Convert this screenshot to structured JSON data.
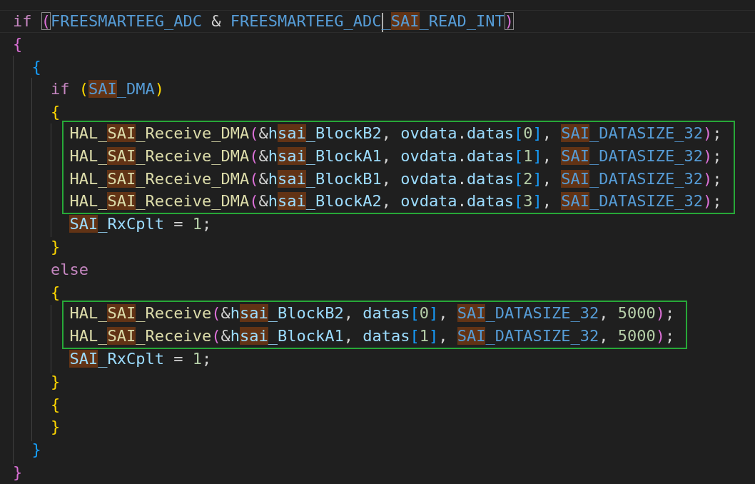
{
  "editor": {
    "blocks": [
      {
        "kind": "line",
        "current": true,
        "tokens": [
          {
            "text": "if ",
            "kind": "keyword",
            "highlighted": false
          },
          {
            "text": "(",
            "kind": "bracket",
            "color": "#da70d6",
            "matched": true,
            "highlighted": false
          },
          {
            "text": "FREESMARTEEG_ADC",
            "kind": "macro",
            "highlighted": false
          },
          {
            "text": " & ",
            "kind": "operator",
            "highlighted": false
          },
          {
            "text": "FREESMARTEEG_ADC",
            "kind": "macro",
            "highlighted": false
          },
          {
            "kind": "cursor"
          },
          {
            "text": "_",
            "kind": "macro",
            "highlighted": false
          },
          {
            "text": "SAI",
            "kind": "macro",
            "highlighted": true
          },
          {
            "text": "_READ_INT",
            "kind": "macro",
            "highlighted": false
          },
          {
            "text": ")",
            "kind": "bracket",
            "color": "#da70d6",
            "matched": true,
            "highlighted": false
          }
        ]
      },
      {
        "kind": "line",
        "current": false,
        "tokens": [
          {
            "text": "{",
            "kind": "bracket",
            "color": "#da70d6",
            "matched": false,
            "highlighted": false
          }
        ]
      },
      {
        "kind": "line",
        "current": false,
        "tokens": [
          {
            "text": "  {",
            "kind": "bracket",
            "color": "#179fff",
            "matched": false,
            "highlighted": false
          }
        ]
      },
      {
        "kind": "line",
        "current": false,
        "tokens": [
          {
            "text": "    if ",
            "kind": "keyword",
            "highlighted": false
          },
          {
            "text": "(",
            "kind": "bracket",
            "color": "#ffd700",
            "matched": false,
            "highlighted": false
          },
          {
            "text": "SAI",
            "kind": "macro",
            "highlighted": true
          },
          {
            "text": "_DMA",
            "kind": "macro",
            "highlighted": false
          },
          {
            "text": ")",
            "kind": "bracket",
            "color": "#ffd700",
            "matched": false,
            "highlighted": false
          }
        ]
      },
      {
        "kind": "line",
        "current": false,
        "tokens": [
          {
            "text": "    {",
            "kind": "bracket",
            "color": "#ffd700",
            "matched": false,
            "highlighted": false
          }
        ]
      },
      {
        "kind": "boxed_group",
        "lines": [
          {
            "current": false,
            "tokens": [
              {
                "text": "      HAL_",
                "kind": "function",
                "highlighted": false
              },
              {
                "text": "SAI",
                "kind": "function",
                "highlighted": true
              },
              {
                "text": "_Receive_DMA",
                "kind": "function",
                "highlighted": false
              },
              {
                "text": "(",
                "kind": "bracket",
                "color": "#da70d6",
                "matched": false,
                "highlighted": false
              },
              {
                "text": "&",
                "kind": "operator",
                "highlighted": false
              },
              {
                "text": "h",
                "kind": "variable",
                "highlighted": false
              },
              {
                "text": "sai",
                "kind": "variable",
                "highlighted": true
              },
              {
                "text": "_BlockB2",
                "kind": "variable",
                "highlighted": false
              },
              {
                "text": ", ",
                "kind": "operator",
                "highlighted": false
              },
              {
                "text": "ovdata",
                "kind": "variable",
                "highlighted": false
              },
              {
                "text": ".",
                "kind": "operator",
                "highlighted": false
              },
              {
                "text": "datas",
                "kind": "variable",
                "highlighted": false
              },
              {
                "text": "[",
                "kind": "bracket",
                "color": "#179fff",
                "matched": false,
                "highlighted": false
              },
              {
                "text": "0",
                "kind": "number",
                "highlighted": false
              },
              {
                "text": "]",
                "kind": "bracket",
                "color": "#179fff",
                "matched": false,
                "highlighted": false
              },
              {
                "text": ", ",
                "kind": "operator",
                "highlighted": false
              },
              {
                "text": "SAI",
                "kind": "macro",
                "highlighted": true
              },
              {
                "text": "_DATASIZE_32",
                "kind": "macro",
                "highlighted": false
              },
              {
                "text": ")",
                "kind": "bracket",
                "color": "#da70d6",
                "matched": false,
                "highlighted": false
              },
              {
                "text": ";",
                "kind": "operator",
                "highlighted": false
              }
            ]
          },
          {
            "current": false,
            "tokens": [
              {
                "text": "      HAL_",
                "kind": "function",
                "highlighted": false
              },
              {
                "text": "SAI",
                "kind": "function",
                "highlighted": true
              },
              {
                "text": "_Receive_DMA",
                "kind": "function",
                "highlighted": false
              },
              {
                "text": "(",
                "kind": "bracket",
                "color": "#da70d6",
                "matched": false,
                "highlighted": false
              },
              {
                "text": "&",
                "kind": "operator",
                "highlighted": false
              },
              {
                "text": "h",
                "kind": "variable",
                "highlighted": false
              },
              {
                "text": "sai",
                "kind": "variable",
                "highlighted": true
              },
              {
                "text": "_BlockA1",
                "kind": "variable",
                "highlighted": false
              },
              {
                "text": ", ",
                "kind": "operator",
                "highlighted": false
              },
              {
                "text": "ovdata",
                "kind": "variable",
                "highlighted": false
              },
              {
                "text": ".",
                "kind": "operator",
                "highlighted": false
              },
              {
                "text": "datas",
                "kind": "variable",
                "highlighted": false
              },
              {
                "text": "[",
                "kind": "bracket",
                "color": "#179fff",
                "matched": false,
                "highlighted": false
              },
              {
                "text": "1",
                "kind": "number",
                "highlighted": false
              },
              {
                "text": "]",
                "kind": "bracket",
                "color": "#179fff",
                "matched": false,
                "highlighted": false
              },
              {
                "text": ", ",
                "kind": "operator",
                "highlighted": false
              },
              {
                "text": "SAI",
                "kind": "macro",
                "highlighted": true
              },
              {
                "text": "_DATASIZE_32",
                "kind": "macro",
                "highlighted": false
              },
              {
                "text": ")",
                "kind": "bracket",
                "color": "#da70d6",
                "matched": false,
                "highlighted": false
              },
              {
                "text": ";",
                "kind": "operator",
                "highlighted": false
              }
            ]
          },
          {
            "current": false,
            "tokens": [
              {
                "text": "      HAL_",
                "kind": "function",
                "highlighted": false
              },
              {
                "text": "SAI",
                "kind": "function",
                "highlighted": true
              },
              {
                "text": "_Receive_DMA",
                "kind": "function",
                "highlighted": false
              },
              {
                "text": "(",
                "kind": "bracket",
                "color": "#da70d6",
                "matched": false,
                "highlighted": false
              },
              {
                "text": "&",
                "kind": "operator",
                "highlighted": false
              },
              {
                "text": "h",
                "kind": "variable",
                "highlighted": false
              },
              {
                "text": "sai",
                "kind": "variable",
                "highlighted": true
              },
              {
                "text": "_BlockB1",
                "kind": "variable",
                "highlighted": false
              },
              {
                "text": ", ",
                "kind": "operator",
                "highlighted": false
              },
              {
                "text": "ovdata",
                "kind": "variable",
                "highlighted": false
              },
              {
                "text": ".",
                "kind": "operator",
                "highlighted": false
              },
              {
                "text": "datas",
                "kind": "variable",
                "highlighted": false
              },
              {
                "text": "[",
                "kind": "bracket",
                "color": "#179fff",
                "matched": false,
                "highlighted": false
              },
              {
                "text": "2",
                "kind": "number",
                "highlighted": false
              },
              {
                "text": "]",
                "kind": "bracket",
                "color": "#179fff",
                "matched": false,
                "highlighted": false
              },
              {
                "text": ", ",
                "kind": "operator",
                "highlighted": false
              },
              {
                "text": "SAI",
                "kind": "macro",
                "highlighted": true
              },
              {
                "text": "_DATASIZE_32",
                "kind": "macro",
                "highlighted": false
              },
              {
                "text": ")",
                "kind": "bracket",
                "color": "#da70d6",
                "matched": false,
                "highlighted": false
              },
              {
                "text": ";",
                "kind": "operator",
                "highlighted": false
              }
            ]
          },
          {
            "current": false,
            "tokens": [
              {
                "text": "      HAL_",
                "kind": "function",
                "highlighted": false
              },
              {
                "text": "SAI",
                "kind": "function",
                "highlighted": true
              },
              {
                "text": "_Receive_DMA",
                "kind": "function",
                "highlighted": false
              },
              {
                "text": "(",
                "kind": "bracket",
                "color": "#da70d6",
                "matched": false,
                "highlighted": false
              },
              {
                "text": "&",
                "kind": "operator",
                "highlighted": false
              },
              {
                "text": "h",
                "kind": "variable",
                "highlighted": false
              },
              {
                "text": "sai",
                "kind": "variable",
                "highlighted": true
              },
              {
                "text": "_BlockA2",
                "kind": "variable",
                "highlighted": false
              },
              {
                "text": ", ",
                "kind": "operator",
                "highlighted": false
              },
              {
                "text": "ovdata",
                "kind": "variable",
                "highlighted": false
              },
              {
                "text": ".",
                "kind": "operator",
                "highlighted": false
              },
              {
                "text": "datas",
                "kind": "variable",
                "highlighted": false
              },
              {
                "text": "[",
                "kind": "bracket",
                "color": "#179fff",
                "matched": false,
                "highlighted": false
              },
              {
                "text": "3",
                "kind": "number",
                "highlighted": false
              },
              {
                "text": "]",
                "kind": "bracket",
                "color": "#179fff",
                "matched": false,
                "highlighted": false
              },
              {
                "text": ", ",
                "kind": "operator",
                "highlighted": false
              },
              {
                "text": "SAI",
                "kind": "macro",
                "highlighted": true
              },
              {
                "text": "_DATASIZE_32",
                "kind": "macro",
                "highlighted": false
              },
              {
                "text": ")",
                "kind": "bracket",
                "color": "#da70d6",
                "matched": false,
                "highlighted": false
              },
              {
                "text": ";",
                "kind": "operator",
                "highlighted": false
              }
            ]
          }
        ]
      },
      {
        "kind": "line",
        "current": false,
        "tokens": [
          {
            "text": "      SAI",
            "kind": "variable",
            "highlighted": true
          },
          {
            "text": "_RxCplt",
            "kind": "variable",
            "highlighted": false
          },
          {
            "text": " = ",
            "kind": "operator",
            "highlighted": false
          },
          {
            "text": "1",
            "kind": "number",
            "highlighted": false
          },
          {
            "text": ";",
            "kind": "operator",
            "highlighted": false
          }
        ]
      },
      {
        "kind": "line",
        "current": false,
        "tokens": [
          {
            "text": "    }",
            "kind": "bracket",
            "color": "#ffd700",
            "matched": false,
            "highlighted": false
          }
        ]
      },
      {
        "kind": "line",
        "current": false,
        "tokens": [
          {
            "text": "    else",
            "kind": "keyword",
            "highlighted": false
          }
        ]
      },
      {
        "kind": "line",
        "current": false,
        "tokens": [
          {
            "text": "    {",
            "kind": "bracket",
            "color": "#ffd700",
            "matched": false,
            "highlighted": false
          }
        ]
      },
      {
        "kind": "boxed_group",
        "lines": [
          {
            "current": false,
            "tokens": [
              {
                "text": "      HAL_",
                "kind": "function",
                "highlighted": false
              },
              {
                "text": "SAI",
                "kind": "function",
                "highlighted": true
              },
              {
                "text": "_Receive",
                "kind": "function",
                "highlighted": false
              },
              {
                "text": "(",
                "kind": "bracket",
                "color": "#da70d6",
                "matched": false,
                "highlighted": false
              },
              {
                "text": "&",
                "kind": "operator",
                "highlighted": false
              },
              {
                "text": "h",
                "kind": "variable",
                "highlighted": false
              },
              {
                "text": "sai",
                "kind": "variable",
                "highlighted": true
              },
              {
                "text": "_BlockB2",
                "kind": "variable",
                "highlighted": false
              },
              {
                "text": ", ",
                "kind": "operator",
                "highlighted": false
              },
              {
                "text": "datas",
                "kind": "variable",
                "highlighted": false
              },
              {
                "text": "[",
                "kind": "bracket",
                "color": "#179fff",
                "matched": false,
                "highlighted": false
              },
              {
                "text": "0",
                "kind": "number",
                "highlighted": false
              },
              {
                "text": "]",
                "kind": "bracket",
                "color": "#179fff",
                "matched": false,
                "highlighted": false
              },
              {
                "text": ", ",
                "kind": "operator",
                "highlighted": false
              },
              {
                "text": "SAI",
                "kind": "macro",
                "highlighted": true
              },
              {
                "text": "_DATASIZE_32",
                "kind": "macro",
                "highlighted": false
              },
              {
                "text": ", ",
                "kind": "operator",
                "highlighted": false
              },
              {
                "text": "5000",
                "kind": "number",
                "highlighted": false
              },
              {
                "text": ")",
                "kind": "bracket",
                "color": "#da70d6",
                "matched": false,
                "highlighted": false
              },
              {
                "text": ";",
                "kind": "operator",
                "highlighted": false
              }
            ]
          },
          {
            "current": false,
            "tokens": [
              {
                "text": "      HAL_",
                "kind": "function",
                "highlighted": false
              },
              {
                "text": "SAI",
                "kind": "function",
                "highlighted": true
              },
              {
                "text": "_Receive",
                "kind": "function",
                "highlighted": false
              },
              {
                "text": "(",
                "kind": "bracket",
                "color": "#da70d6",
                "matched": false,
                "highlighted": false
              },
              {
                "text": "&",
                "kind": "operator",
                "highlighted": false
              },
              {
                "text": "h",
                "kind": "variable",
                "highlighted": false
              },
              {
                "text": "sai",
                "kind": "variable",
                "highlighted": true
              },
              {
                "text": "_BlockA1",
                "kind": "variable",
                "highlighted": false
              },
              {
                "text": ", ",
                "kind": "operator",
                "highlighted": false
              },
              {
                "text": "datas",
                "kind": "variable",
                "highlighted": false
              },
              {
                "text": "[",
                "kind": "bracket",
                "color": "#179fff",
                "matched": false,
                "highlighted": false
              },
              {
                "text": "1",
                "kind": "number",
                "highlighted": false
              },
              {
                "text": "]",
                "kind": "bracket",
                "color": "#179fff",
                "matched": false,
                "highlighted": false
              },
              {
                "text": ", ",
                "kind": "operator",
                "highlighted": false
              },
              {
                "text": "SAI",
                "kind": "macro",
                "highlighted": true
              },
              {
                "text": "_DATASIZE_32",
                "kind": "macro",
                "highlighted": false
              },
              {
                "text": ", ",
                "kind": "operator",
                "highlighted": false
              },
              {
                "text": "5000",
                "kind": "number",
                "highlighted": false
              },
              {
                "text": ")",
                "kind": "bracket",
                "color": "#da70d6",
                "matched": false,
                "highlighted": false
              },
              {
                "text": ";",
                "kind": "operator",
                "highlighted": false
              }
            ]
          }
        ]
      },
      {
        "kind": "line",
        "current": false,
        "tokens": [
          {
            "text": "      SAI",
            "kind": "variable",
            "highlighted": true
          },
          {
            "text": "_RxCplt",
            "kind": "variable",
            "highlighted": false
          },
          {
            "text": " = ",
            "kind": "operator",
            "highlighted": false
          },
          {
            "text": "1",
            "kind": "number",
            "highlighted": false
          },
          {
            "text": ";",
            "kind": "operator",
            "highlighted": false
          }
        ]
      },
      {
        "kind": "line",
        "current": false,
        "tokens": [
          {
            "text": "    }",
            "kind": "bracket",
            "color": "#ffd700",
            "matched": false,
            "highlighted": false
          }
        ]
      },
      {
        "kind": "line",
        "current": false,
        "tokens": [
          {
            "text": "    {",
            "kind": "bracket",
            "color": "#ffd700",
            "matched": false,
            "highlighted": false
          }
        ]
      },
      {
        "kind": "line",
        "current": false,
        "tokens": [
          {
            "text": "    }",
            "kind": "bracket",
            "color": "#ffd700",
            "matched": false,
            "highlighted": false
          }
        ]
      },
      {
        "kind": "line",
        "current": false,
        "tokens": [
          {
            "text": "  }",
            "kind": "bracket",
            "color": "#179fff",
            "matched": false,
            "highlighted": false
          }
        ]
      },
      {
        "kind": "line",
        "current": false,
        "tokens": [
          {
            "text": "}",
            "kind": "bracket",
            "color": "#da70d6",
            "matched": false,
            "highlighted": false
          }
        ]
      }
    ]
  }
}
